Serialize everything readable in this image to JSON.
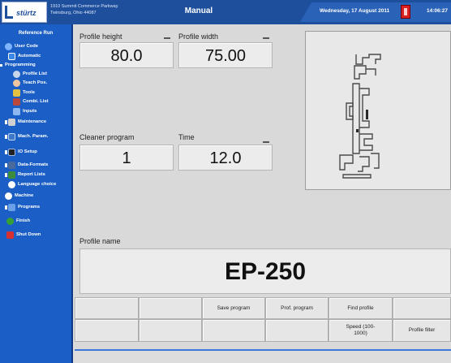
{
  "header": {
    "logo": "stürtz",
    "company_line1": "1910 Summit Commerce Parkway",
    "company_line2": "Twinsburg, Ohio 44087",
    "mode": "Manual",
    "date": "Wednesday, 17 August 2011",
    "time": "14:06:27"
  },
  "sidebar": {
    "title": "Reference Run",
    "items": [
      {
        "label": "User Code",
        "icon": "user-icon"
      },
      {
        "label": "Automatic",
        "icon": "automatic-icon"
      },
      {
        "label": "Programming",
        "icon": "expand-icon"
      },
      {
        "label": "Profile List",
        "icon": "gear-icon"
      },
      {
        "label": "Teach Pos.",
        "icon": "hand-icon"
      },
      {
        "label": "Tools",
        "icon": "tool-icon"
      },
      {
        "label": "Combi. List",
        "icon": "combi-icon"
      },
      {
        "label": "Inputs",
        "icon": "inputs-icon"
      },
      {
        "label": "Maintenance",
        "icon": "maintenance-icon"
      },
      {
        "label": "Mach. Param.",
        "icon": "machine-param-icon"
      },
      {
        "label": "IO Setup",
        "icon": "io-icon"
      },
      {
        "label": "Data-Formats",
        "icon": "data-icon"
      },
      {
        "label": "Report Lists",
        "icon": "report-icon"
      },
      {
        "label": "Language choice",
        "icon": "language-icon"
      },
      {
        "label": "Machine",
        "icon": "machine-icon"
      },
      {
        "label": "Programs",
        "icon": "programs-icon"
      },
      {
        "label": "Finish",
        "icon": "finish-icon"
      },
      {
        "label": "Shut Down",
        "icon": "shutdown-icon"
      }
    ]
  },
  "fields": {
    "profile_height": {
      "label": "Profile height",
      "value": "80.0"
    },
    "profile_width": {
      "label": "Profile width",
      "value": "75.00"
    },
    "cleaner_program": {
      "label": "Cleaner program",
      "value": "1"
    },
    "time": {
      "label": "Time",
      "value": "12.0"
    },
    "profile_name": {
      "label": "Profile name",
      "value": "EP-250"
    }
  },
  "buttons": {
    "row1": [
      "",
      "",
      "Save program",
      "Prof. program",
      "Find profile",
      ""
    ],
    "row2": [
      "",
      "",
      "",
      "",
      "Speed (100-1000)",
      "Profile filter"
    ]
  },
  "colors": {
    "header_blue": "#1d4f9c",
    "sidebar_blue": "#1b5fc6",
    "panel_gray": "#d9d9d9"
  }
}
